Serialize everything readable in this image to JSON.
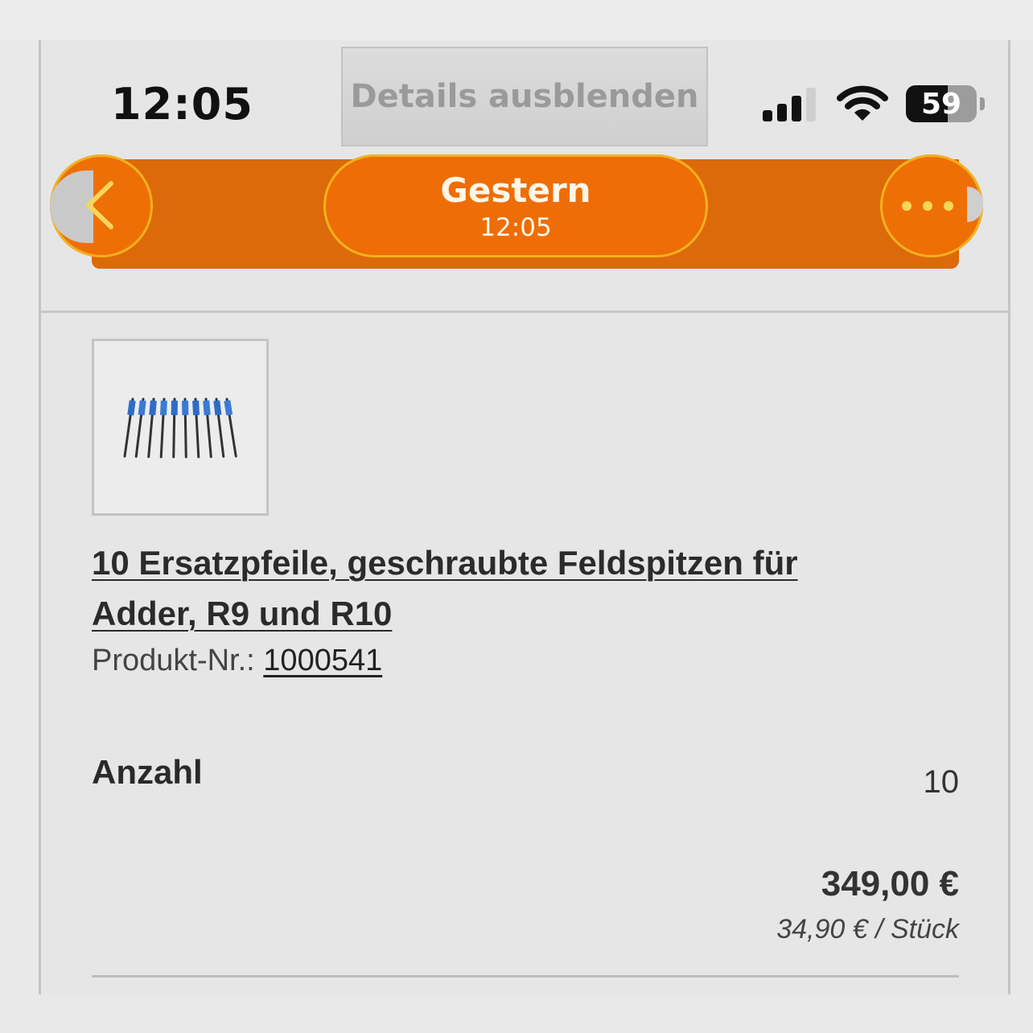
{
  "status_bar": {
    "time": "12:05",
    "battery": "59"
  },
  "overlay": {
    "details_button": "Details ausblenden"
  },
  "nav": {
    "title": "Gestern",
    "subtitle": "12:05",
    "accent_color": "#ee6d06"
  },
  "product": {
    "title": "10 Ersatzpfeile, geschraubte Feldspitzen für Adder, R9 und R10",
    "number_label": "Produkt-Nr.:",
    "number": "1000541",
    "quantity_label": "Anzahl",
    "quantity": "10",
    "total_price": "349,00 €",
    "unit_price": "34,90 € / Stück"
  }
}
